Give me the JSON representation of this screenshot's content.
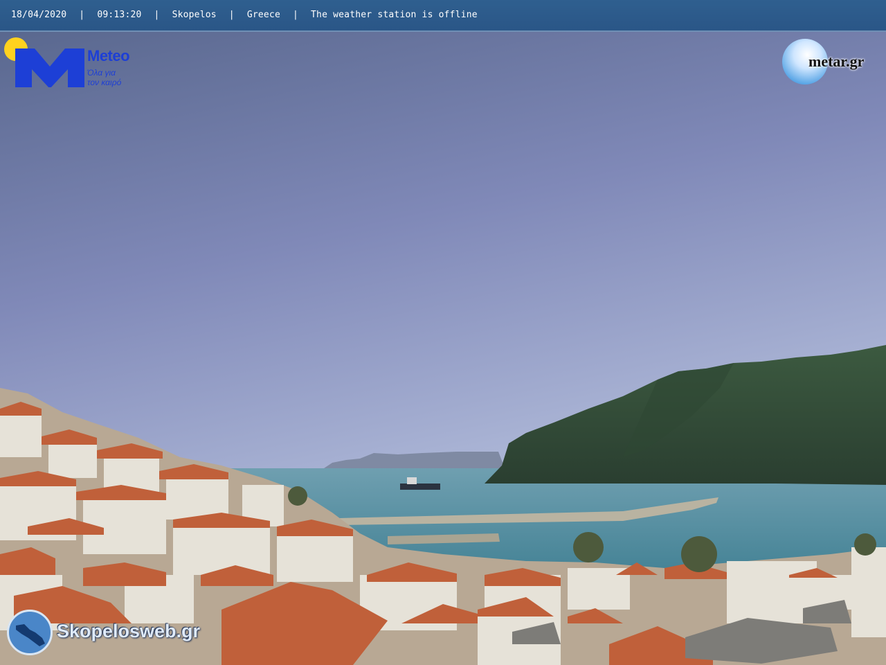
{
  "overlay": {
    "date": "18/04/2020",
    "time": "09:13:20",
    "location": "Skopelos",
    "country": "Greece",
    "status": "The weather station is offline",
    "separator": "|"
  },
  "logos": {
    "meteo": {
      "name": "Meteo",
      "slogan_line1": "Όλα για",
      "slogan_line2": "τον καιρό"
    },
    "metar": {
      "name": "metar.gr"
    },
    "skopelos": {
      "name": "Skopelosweb.gr"
    }
  },
  "colors": {
    "sky_top": "#5b6b8e",
    "sky_bottom": "#a9b2d6",
    "sea": "#4f8c9f",
    "roofs": "#c0603a",
    "hills": "#35503a",
    "bar": "#2f5f8f"
  }
}
